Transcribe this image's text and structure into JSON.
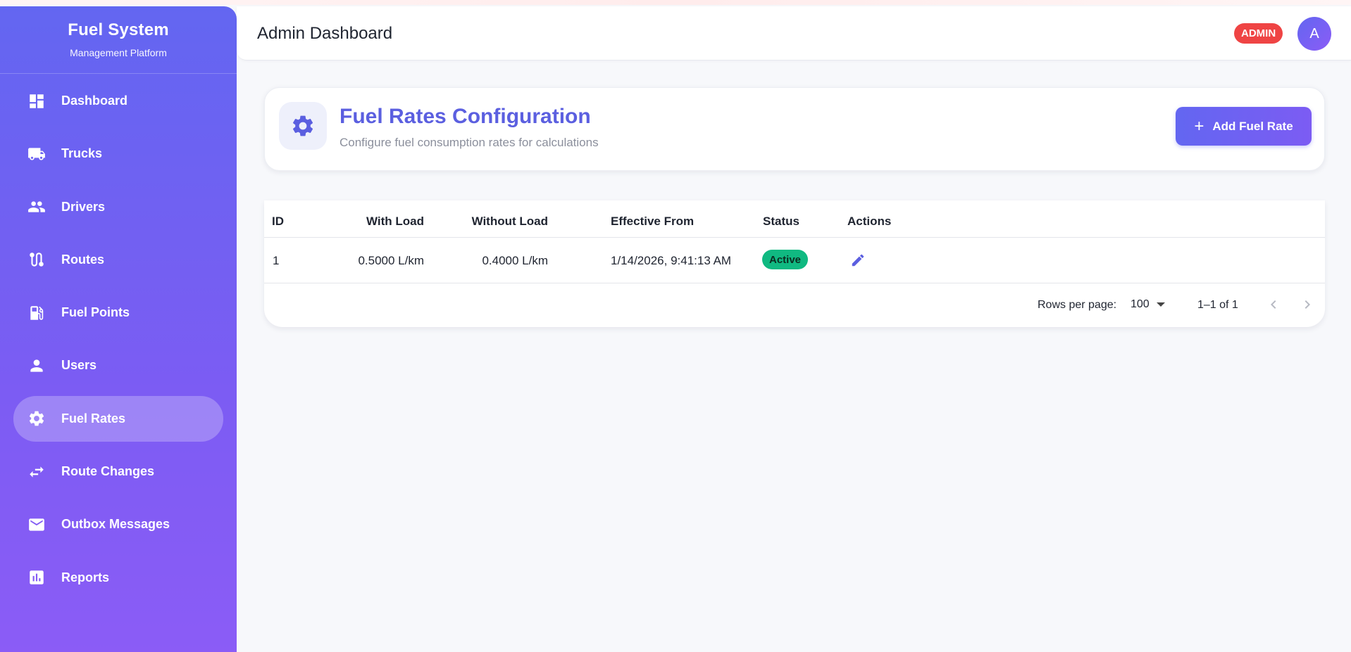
{
  "sidebar": {
    "brand_title": "Fuel System",
    "brand_subtitle": "Management Platform",
    "items": [
      {
        "label": "Dashboard",
        "icon": "dashboard-icon"
      },
      {
        "label": "Trucks",
        "icon": "truck-icon"
      },
      {
        "label": "Drivers",
        "icon": "people-icon"
      },
      {
        "label": "Routes",
        "icon": "route-icon"
      },
      {
        "label": "Fuel Points",
        "icon": "fuel-pump-icon"
      },
      {
        "label": "Users",
        "icon": "person-icon"
      },
      {
        "label": "Fuel Rates",
        "icon": "gear-icon",
        "active": true
      },
      {
        "label": "Route Changes",
        "icon": "swap-arrows-icon"
      },
      {
        "label": "Outbox Messages",
        "icon": "mail-icon"
      },
      {
        "label": "Reports",
        "icon": "bar-chart-icon"
      }
    ]
  },
  "header": {
    "title": "Admin Dashboard",
    "role_badge": "ADMIN",
    "avatar_initial": "A"
  },
  "config": {
    "title": "Fuel Rates Configuration",
    "subtitle": "Configure fuel consumption rates for calculations",
    "add_button_label": "Add Fuel Rate",
    "icon": "gear-icon"
  },
  "table": {
    "headers": {
      "id": "ID",
      "with_load": "With Load",
      "without_load": "Without Load",
      "effective_from": "Effective From",
      "status": "Status",
      "actions": "Actions"
    },
    "rows": [
      {
        "id": "1",
        "with_load": "0.5000 L/km",
        "without_load": "0.4000 L/km",
        "effective_from": "1/14/2026, 9:41:13 AM",
        "status": "Active",
        "action_icon": "edit-pencil-icon"
      }
    ],
    "pagination": {
      "rows_per_page_label": "Rows per page:",
      "rows_per_page_value": "100",
      "range": "1–1 of 1"
    }
  },
  "colors": {
    "accent": "#6366f1",
    "accent_end": "#8b5cf6",
    "danger": "#ef4444",
    "success": "#10b981"
  }
}
